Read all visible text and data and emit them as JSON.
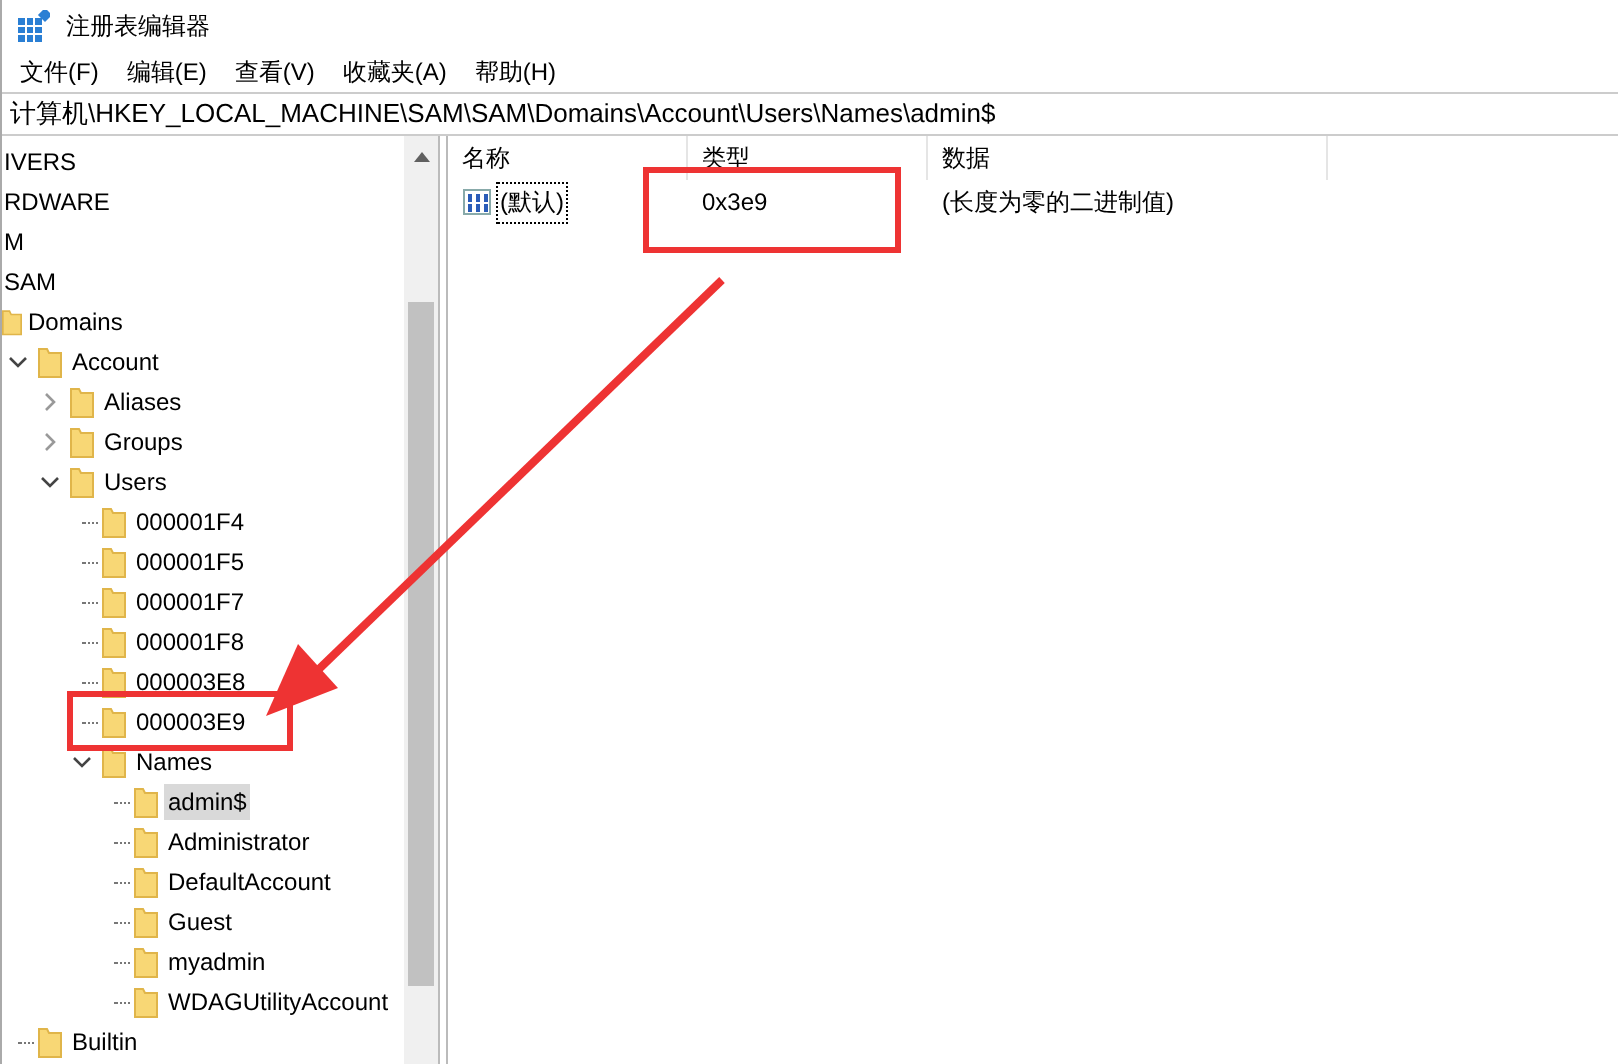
{
  "window": {
    "title": "注册表编辑器"
  },
  "menu": [
    "文件(F)",
    "编辑(E)",
    "查看(V)",
    "收藏夹(A)",
    "帮助(H)"
  ],
  "address": "计算机\\HKEY_LOCAL_MACHINE\\SAM\\SAM\\Domains\\Account\\Users\\Names\\admin$",
  "tree": [
    {
      "label": "IVERS",
      "selected": false
    },
    {
      "label": "RDWARE",
      "selected": false
    },
    {
      "label": "M",
      "selected": false
    },
    {
      "label": "SAM",
      "selected": false,
      "children": [
        {
          "label": "Domains",
          "selected": false,
          "children": [
            {
              "label": "Account",
              "selected": false,
              "expanded": true,
              "children": [
                {
                  "label": "Aliases",
                  "selected": false,
                  "expanded": false
                },
                {
                  "label": "Groups",
                  "selected": false,
                  "expanded": false
                },
                {
                  "label": "Users",
                  "selected": false,
                  "expanded": true,
                  "children": [
                    {
                      "label": "000001F4",
                      "selected": false
                    },
                    {
                      "label": "000001F5",
                      "selected": false
                    },
                    {
                      "label": "000001F7",
                      "selected": false
                    },
                    {
                      "label": "000001F8",
                      "selected": false
                    },
                    {
                      "label": "000003E8",
                      "selected": false
                    },
                    {
                      "label": "000003E9",
                      "selected": false
                    },
                    {
                      "label": "Names",
                      "selected": false,
                      "expanded": true,
                      "children": [
                        {
                          "label": "admin$",
                          "selected": true
                        },
                        {
                          "label": "Administrator",
                          "selected": false
                        },
                        {
                          "label": "DefaultAccount",
                          "selected": false
                        },
                        {
                          "label": "Guest",
                          "selected": false
                        },
                        {
                          "label": "myadmin",
                          "selected": false
                        },
                        {
                          "label": "WDAGUtilityAccount",
                          "selected": false
                        }
                      ]
                    }
                  ]
                }
              ]
            },
            {
              "label": "Builtin",
              "selected": false
            }
          ]
        }
      ]
    }
  ],
  "values": {
    "columns": [
      "名称",
      "类型",
      "数据"
    ],
    "rows": [
      {
        "name": "(默认)",
        "type": "0x3e9",
        "data": "(长度为零的二进制值)",
        "focused": true
      }
    ]
  }
}
